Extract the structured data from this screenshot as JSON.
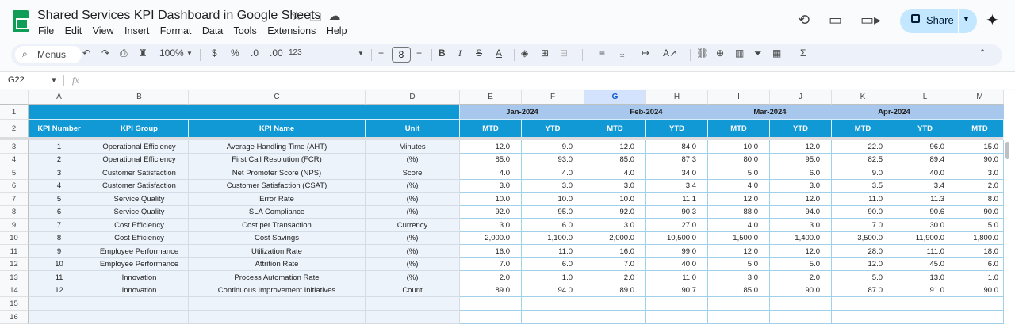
{
  "title_bar": {
    "doc_title": "Shared Services KPI Dashboard in Google Sheets",
    "menu": [
      "File",
      "Edit",
      "View",
      "Insert",
      "Format",
      "Data",
      "Tools",
      "Extensions",
      "Help"
    ],
    "share_label": "Share"
  },
  "toolbar": {
    "menus_label": "Menus",
    "zoom": "100%",
    "currency": "$",
    "percent": "%",
    "decrease_decimal": ".0",
    "increase_decimal": ".00",
    "number_format": "123",
    "font_size": "8",
    "bold": "B",
    "italic": "I"
  },
  "formula_bar": {
    "cell_ref": "G22",
    "fx": "fx"
  },
  "columns": [
    "A",
    "B",
    "C",
    "D",
    "E",
    "F",
    "G",
    "H",
    "I",
    "J",
    "K",
    "L",
    "M"
  ],
  "row_numbers": [
    "1",
    "2",
    "3",
    "4",
    "5",
    "6",
    "7",
    "8",
    "9",
    "10",
    "11",
    "12",
    "13",
    "14",
    "15",
    "16"
  ],
  "headers": {
    "kpi_number": "KPI Number",
    "kpi_group": "KPI Group",
    "kpi_name": "KPI Name",
    "unit": "Unit",
    "months": [
      "Jan-2024",
      "Feb-2024",
      "Mar-2024",
      "Apr-2024"
    ],
    "mtd": "MTD",
    "ytd": "YTD"
  },
  "rows": [
    {
      "num": "1",
      "group": "Operational Efficiency",
      "name": "Average Handling Time (AHT)",
      "unit": "Minutes",
      "vals": [
        "12.0",
        "9.0",
        "12.0",
        "84.0",
        "10.0",
        "12.0",
        "22.0",
        "96.0",
        "15.0"
      ]
    },
    {
      "num": "2",
      "group": "Operational Efficiency",
      "name": "First Call Resolution (FCR)",
      "unit": "(%)",
      "vals": [
        "85.0",
        "93.0",
        "85.0",
        "87.3",
        "80.0",
        "95.0",
        "82.5",
        "89.4",
        "90.0"
      ]
    },
    {
      "num": "3",
      "group": "Customer Satisfaction",
      "name": "Net Promoter Score (NPS)",
      "unit": "Score",
      "vals": [
        "4.0",
        "4.0",
        "4.0",
        "34.0",
        "5.0",
        "6.0",
        "9.0",
        "40.0",
        "3.0"
      ]
    },
    {
      "num": "4",
      "group": "Customer Satisfaction",
      "name": "Customer Satisfaction (CSAT)",
      "unit": "(%)",
      "vals": [
        "3.0",
        "3.0",
        "3.0",
        "3.4",
        "4.0",
        "3.0",
        "3.5",
        "3.4",
        "2.0"
      ]
    },
    {
      "num": "5",
      "group": "Service Quality",
      "name": "Error Rate",
      "unit": "(%)",
      "vals": [
        "10.0",
        "10.0",
        "10.0",
        "11.1",
        "12.0",
        "12.0",
        "11.0",
        "11.3",
        "8.0"
      ]
    },
    {
      "num": "6",
      "group": "Service Quality",
      "name": "SLA Compliance",
      "unit": "(%)",
      "vals": [
        "92.0",
        "95.0",
        "92.0",
        "90.3",
        "88.0",
        "94.0",
        "90.0",
        "90.6",
        "90.0"
      ]
    },
    {
      "num": "7",
      "group": "Cost Efficiency",
      "name": "Cost per Transaction",
      "unit": "Currency",
      "vals": [
        "3.0",
        "6.0",
        "3.0",
        "27.0",
        "4.0",
        "3.0",
        "7.0",
        "30.0",
        "5.0"
      ]
    },
    {
      "num": "8",
      "group": "Cost Efficiency",
      "name": "Cost Savings",
      "unit": "(%)",
      "vals": [
        "2,000.0",
        "1,100.0",
        "2,000.0",
        "10,500.0",
        "1,500.0",
        "1,400.0",
        "3,500.0",
        "11,900.0",
        "1,800.0"
      ]
    },
    {
      "num": "9",
      "group": "Employee Performance",
      "name": "Utilization Rate",
      "unit": "(%)",
      "vals": [
        "16.0",
        "11.0",
        "16.0",
        "99.0",
        "12.0",
        "12.0",
        "28.0",
        "111.0",
        "18.0"
      ]
    },
    {
      "num": "10",
      "group": "Employee Performance",
      "name": "Attrition Rate",
      "unit": "(%)",
      "vals": [
        "7.0",
        "6.0",
        "7.0",
        "40.0",
        "5.0",
        "5.0",
        "12.0",
        "45.0",
        "6.0"
      ]
    },
    {
      "num": "11",
      "group": "Innovation",
      "name": "Process Automation Rate",
      "unit": "(%)",
      "vals": [
        "2.0",
        "1.0",
        "2.0",
        "11.0",
        "3.0",
        "2.0",
        "5.0",
        "13.0",
        "1.0"
      ]
    },
    {
      "num": "12",
      "group": "Innovation",
      "name": "Continuous Improvement Initiatives",
      "unit": "Count",
      "vals": [
        "89.0",
        "94.0",
        "89.0",
        "90.7",
        "85.0",
        "90.0",
        "87.0",
        "91.0",
        "90.0"
      ]
    }
  ],
  "colors": {
    "header_blue": "#1199d6",
    "month_band": "#a7c7ec",
    "label_column_fill": "#edf3fb",
    "share_button": "#c2e7ff"
  }
}
